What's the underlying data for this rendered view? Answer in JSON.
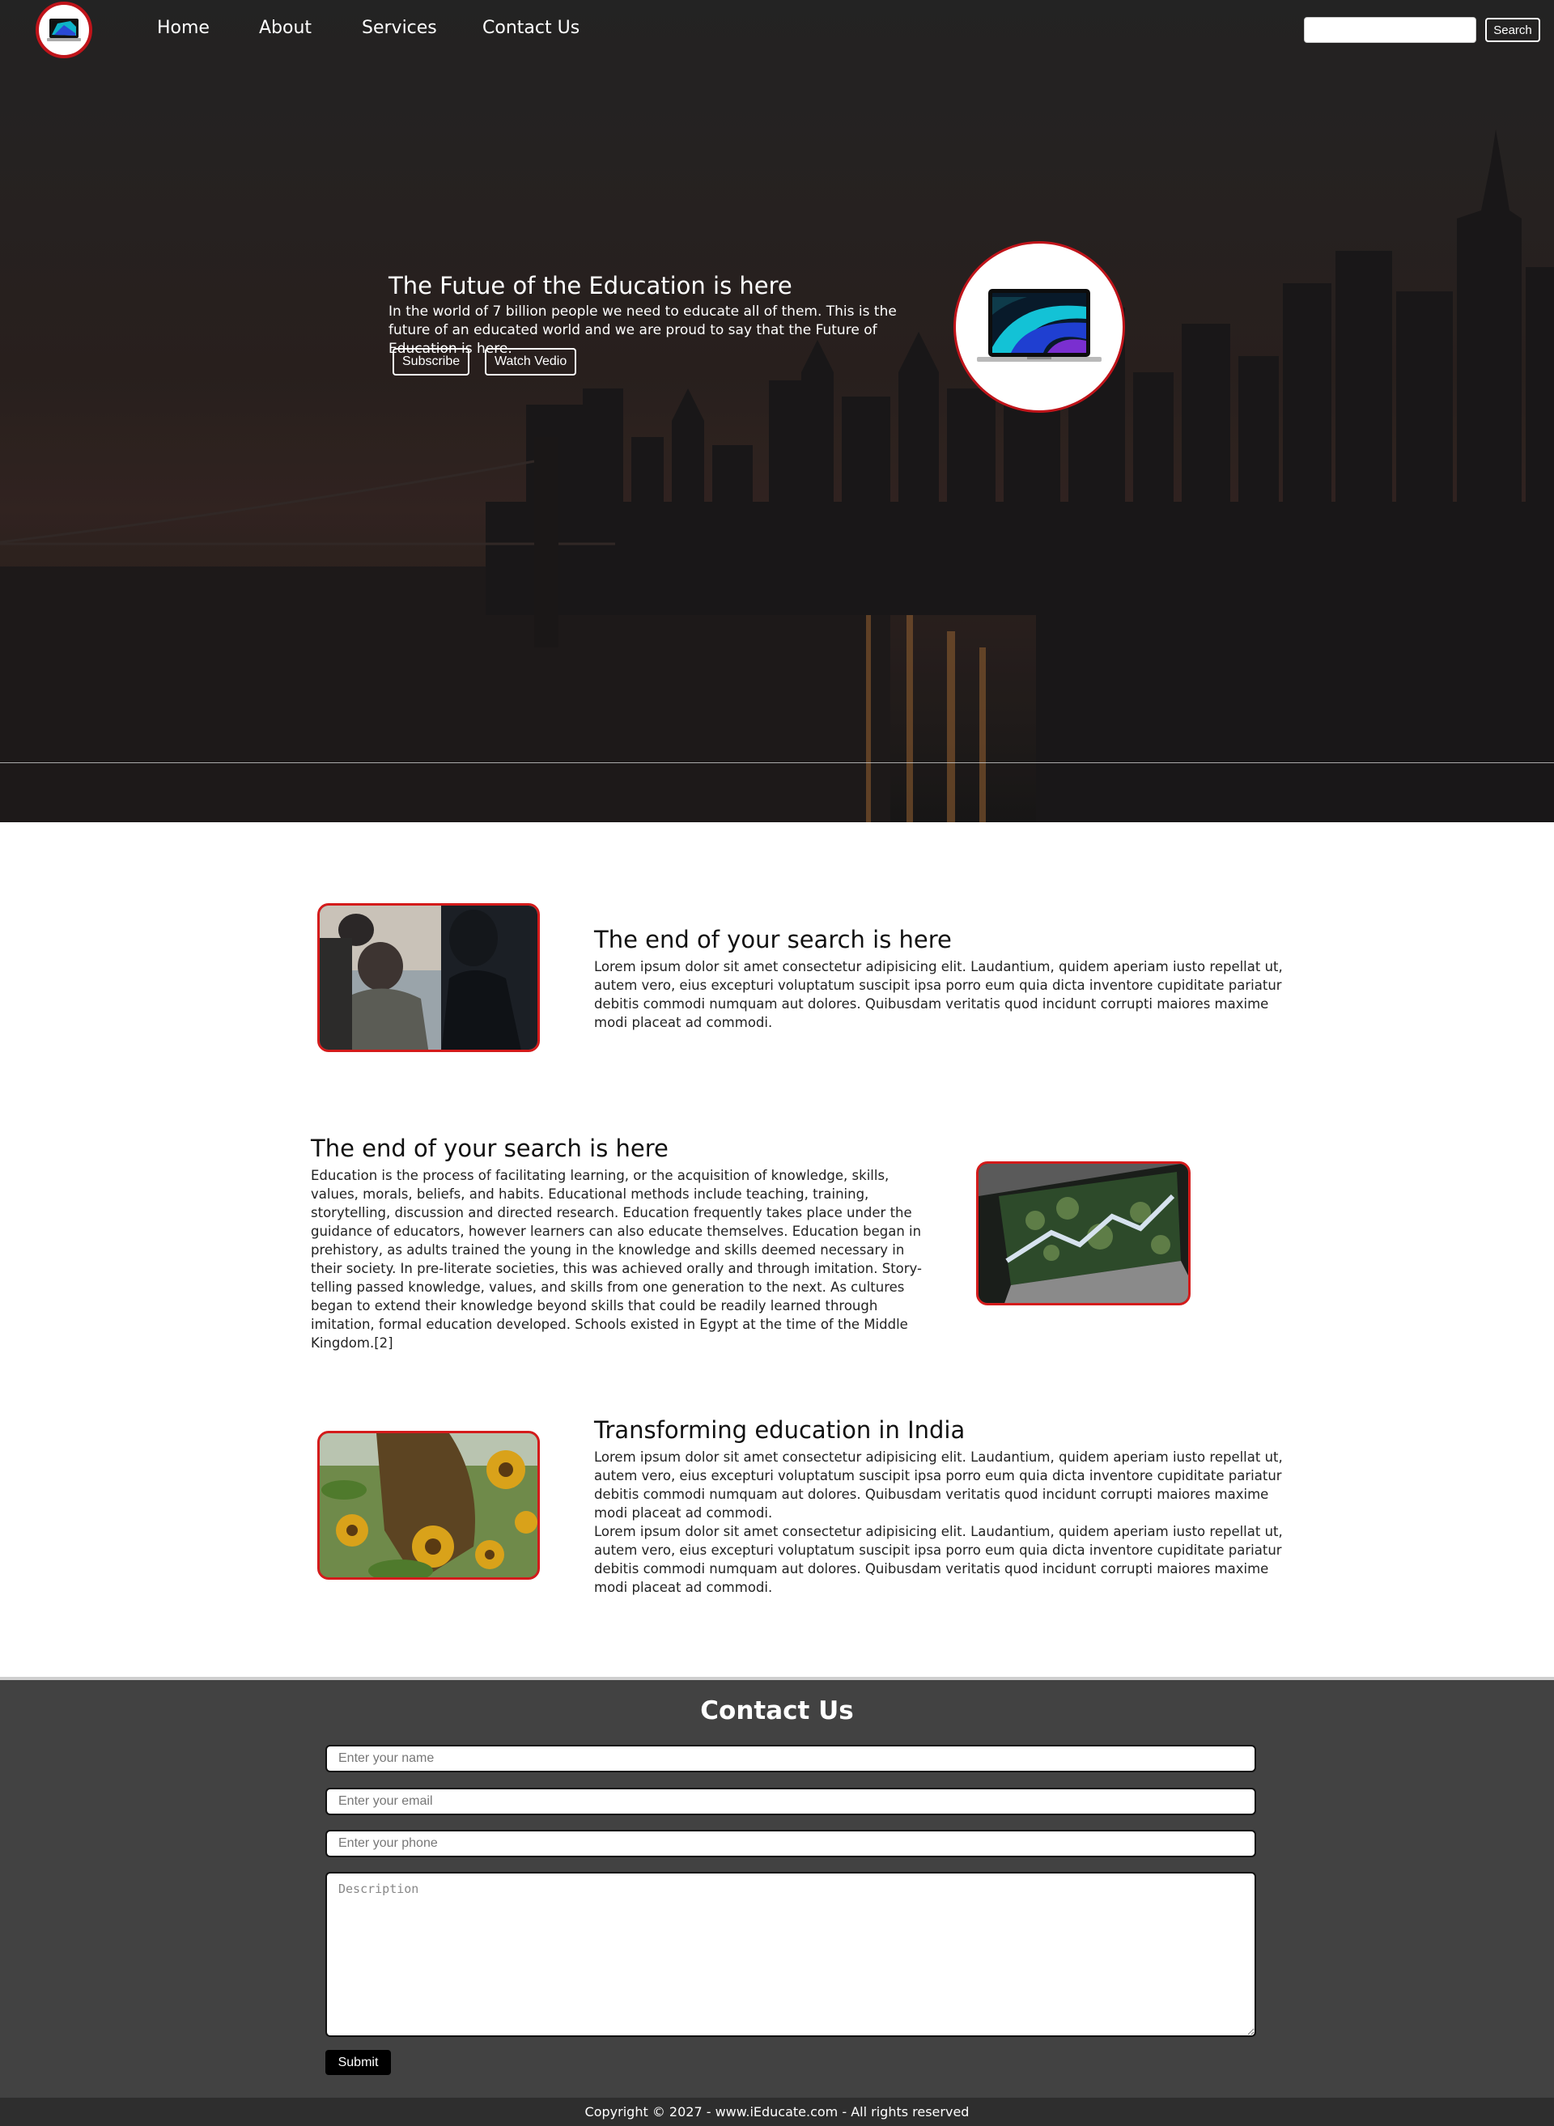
{
  "nav": {
    "links": [
      "Home",
      "About",
      "Services",
      "Contact Us"
    ],
    "search_placeholder": "",
    "search_label": "Search"
  },
  "hero": {
    "title": "The Futue of the Education is here",
    "text": "In the world of 7 billion people we need to educate all of them. This is the future of an educated world and we are proud to say that the Future of Education is here.",
    "buttons": [
      "Subscribe",
      "Watch Vedio"
    ]
  },
  "sections": [
    {
      "title": "The end of your search is here",
      "text": "Lorem ipsum dolor sit amet consectetur adipisicing elit. Laudantium, quidem aperiam iusto repellat ut, autem vero, eius excepturi voluptatum suscipit ipsa porro eum quia dicta inventore cupiditate pariatur debitis commodi numquam aut dolores. Quibusdam veritatis quod incidunt corrupti maiores maxime modi placeat ad commodi."
    },
    {
      "title": "The end of your search is here",
      "text": "Education is the process of facilitating learning, or the acquisition of knowledge, skills, values, morals, beliefs, and habits. Educational methods include teaching, training, storytelling, discussion and directed research. Education frequently takes place under the guidance of educators, however learners can also educate themselves. Education began in prehistory, as adults trained the young in the knowledge and skills deemed necessary in their society. In pre-literate societies, this was achieved orally and through imitation. Story-telling passed knowledge, values, and skills from one generation to the next. As cultures began to extend their knowledge beyond skills that could be readily learned through imitation, formal education developed. Schools existed in Egypt at the time of the Middle Kingdom.[2]"
    },
    {
      "title": "Transforming education in India",
      "text": "Lorem ipsum dolor sit amet consectetur adipisicing elit. Laudantium, quidem aperiam iusto repellat ut, autem vero, eius excepturi voluptatum suscipit ipsa porro eum quia dicta inventore cupiditate pariatur debitis commodi numquam aut dolores. Quibusdam veritatis quod incidunt corrupti maiores maxime modi placeat ad commodi.",
      "text2": "Lorem ipsum dolor sit amet consectetur adipisicing elit. Laudantium, quidem aperiam iusto repellat ut, autem vero, eius excepturi voluptatum suscipit ipsa porro eum quia dicta inventore cupiditate pariatur debitis commodi numquam aut dolores. Quibusdam veritatis quod incidunt corrupti maiores maxime modi placeat ad commodi."
    }
  ],
  "contact": {
    "title": "Contact Us",
    "name_placeholder": "Enter your name",
    "email_placeholder": "Enter your email",
    "phone_placeholder": "Enter your phone",
    "description_placeholder": "Description",
    "submit_label": "Submit"
  },
  "footer": {
    "text": "Copyright © 2027 - www.iEducate.com - All rights reserved"
  },
  "colors": {
    "accent_red": "#d41b1b",
    "contact_bg": "#424242",
    "footer_bg": "#2e2e2e"
  }
}
